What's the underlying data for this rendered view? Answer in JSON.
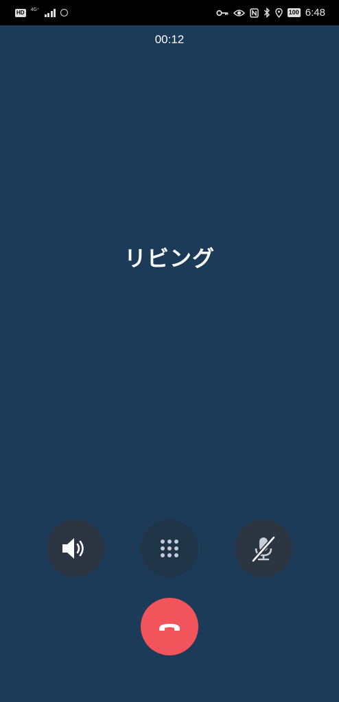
{
  "status_bar": {
    "hd_label": "HD",
    "network_type": "4G⁺",
    "battery_level": "100",
    "time": "6:48"
  },
  "call": {
    "timer": "00:12",
    "contact_name": "リビング"
  },
  "controls": {
    "speaker_icon": "speaker-icon",
    "keypad_icon": "keypad-icon",
    "mute_icon": "mic-off-icon",
    "end_call_icon": "end-call-icon"
  },
  "colors": {
    "background": "#1b3b58",
    "button": "#2b3642",
    "end_call": "#f2545b"
  }
}
